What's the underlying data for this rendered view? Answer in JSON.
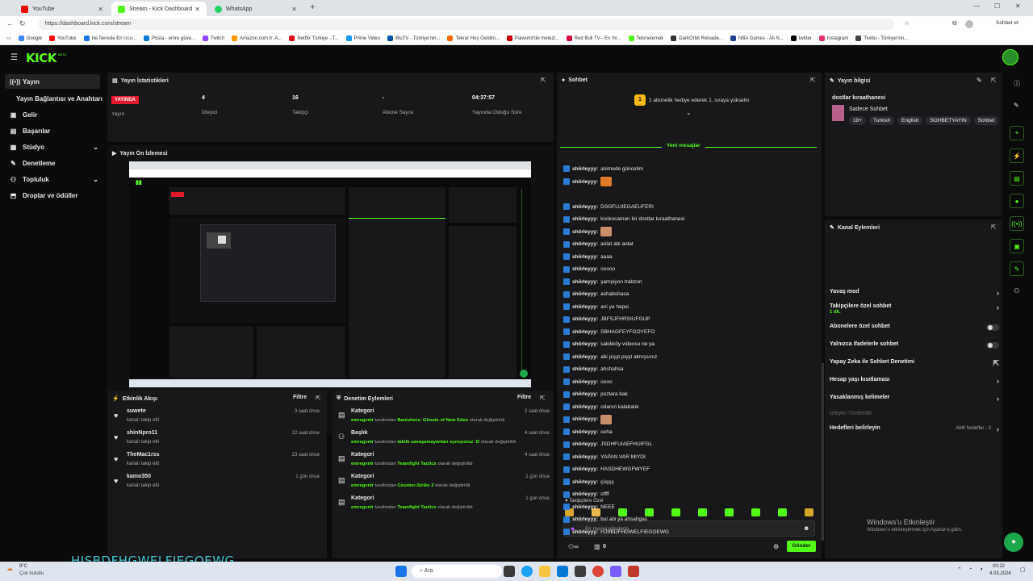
{
  "browser": {
    "tabs": [
      {
        "label": "YouTube",
        "color": "#ff0000"
      },
      {
        "label": "Stream - Kick Dashboard",
        "color": "#53fc18"
      },
      {
        "label": "WhatsApp",
        "color": "#25d366"
      }
    ],
    "url": "https://dashboard.kick.com/stream",
    "profile_label": "Sohbet et",
    "bookmarks": [
      {
        "label": "Google",
        "color": "#4285f4"
      },
      {
        "label": "YouTube",
        "color": "#ff0000"
      },
      {
        "label": "Ne Nerede En Ucu...",
        "color": "#1a73e8"
      },
      {
        "label": "Posta - emre güve...",
        "color": "#0078d4"
      },
      {
        "label": "Twitch",
        "color": "#9146ff"
      },
      {
        "label": "Amazon.com.tr: A...",
        "color": "#ff9900"
      },
      {
        "label": "Netflix Türkiye - T...",
        "color": "#e50914"
      },
      {
        "label": "Prime Video",
        "color": "#1399ff"
      },
      {
        "label": "BluTV - Türkiye'nin...",
        "color": "#0054a6"
      },
      {
        "label": "Tekrar Hoş Geldini...",
        "color": "#ff6600"
      },
      {
        "label": "Palworld'de melezl...",
        "color": "#cc0000"
      },
      {
        "label": "Red Bull TV - En Ye...",
        "color": "#db0a40"
      },
      {
        "label": "Tekmelemek",
        "color": "#53fc18"
      },
      {
        "label": "DarkOrbit Reloade...",
        "color": "#333333"
      },
      {
        "label": "NBA Games - All N...",
        "color": "#1d428a"
      },
      {
        "label": "twitter",
        "color": "#000000"
      },
      {
        "label": "Instagram",
        "color": "#e1306c"
      },
      {
        "label": "Tivibu - Türkiye'nin...",
        "color": "#444444"
      }
    ]
  },
  "app": {
    "logo": "KICK",
    "logo_sup": "BETA",
    "accent": "#53fc18"
  },
  "sidebar": {
    "items": [
      {
        "label": "Yayın",
        "icon": "live-icon"
      },
      {
        "label": "Yayın Bağlantısı ve Anahtarı",
        "icon": ""
      },
      {
        "label": "Gelir",
        "icon": "revenue-icon"
      },
      {
        "label": "Başarılar",
        "icon": "achievements-icon"
      },
      {
        "label": "Stüdyo",
        "icon": "studio-icon"
      },
      {
        "label": "Denetleme",
        "icon": "moderation-icon"
      },
      {
        "label": "Topluluk",
        "icon": "community-icon"
      },
      {
        "label": "Droplar ve ödüller",
        "icon": "drops-icon"
      }
    ]
  },
  "stats": {
    "title": "Yayın İstatistikleri",
    "live_badge": "YAYINDA",
    "live_label": "Yayın",
    "viewers": "4",
    "viewers_label": "İzleyici",
    "followers": "16",
    "followers_label": "Takipçi",
    "subs": "-",
    "subs_label": "Abone Sayısı",
    "uptime": "04:37:57",
    "uptime_label": "Yayında Olduğu Süre"
  },
  "preview": {
    "title": "Yayın Ön İzlemesi"
  },
  "activity": {
    "title": "Etkinlik Akışı",
    "filter": "Filtre",
    "items": [
      {
        "name": "suwete",
        "sub": "kanalı takip etti",
        "time": "3 saat önce"
      },
      {
        "name": "shinNpro11",
        "sub": "kanalı takip etti",
        "time": "22 saat önce"
      },
      {
        "name": "TheMac1rss",
        "sub": "kanalı takip etti",
        "time": "23 saat önce"
      },
      {
        "name": "kamo350",
        "sub": "kanalı takip etti",
        "time": "1 gün önce"
      }
    ]
  },
  "modlog": {
    "title": "Denetim Eylemleri",
    "filter": "Filtre",
    "items": [
      {
        "title": "Kategori",
        "user": "emregvnlr",
        "mid": " tarafından ",
        "value": "Banishers: Ghosts of New Eden",
        "end": " olarak değiştirildi",
        "time": "2 saat önce",
        "icon": "category-icon"
      },
      {
        "title": "Başlık",
        "user": "emregvnlr",
        "mid": " tarafından ",
        "value": "taktik savaşamayanları oynuyoruz :D",
        "end": " olarak değiştirildi",
        "time": "4 saat önce",
        "icon": "title-icon"
      },
      {
        "title": "Kategori",
        "user": "emregvnlr",
        "mid": " tarafından ",
        "value": "Teamfight Tactics",
        "end": " olarak değiştirildi",
        "time": "4 saat önce",
        "icon": "category-icon"
      },
      {
        "title": "Kategori",
        "user": "emregvnlr",
        "mid": " tarafından ",
        "value": "Counter-Strike 2",
        "end": " olarak değiştirildi",
        "time": "1 gün önce",
        "icon": "category-icon"
      },
      {
        "title": "Kategori",
        "user": "emregvnlr",
        "mid": " tarafından ",
        "value": "Teamfight Tactics",
        "end": " olarak değiştirildi",
        "time": "1 gün önce",
        "icon": "category-icon"
      }
    ]
  },
  "chat": {
    "title": "Sohbet",
    "pinned_num": "1",
    "pinned_text": "1 abonelik hediye ederek 1. sıraya yükselin",
    "new_messages": "Yeni mesajlar",
    "messages_before": [
      {
        "user": "shiirleyyy:",
        "text": "animede güncelim",
        "emote": ""
      },
      {
        "user": "shiirleyyy:",
        "text": "",
        "emote": "#e07a2b"
      }
    ],
    "messages": [
      {
        "user": "shiirleyyy:",
        "text": "DSGFLUIEGAEUFERI",
        "emote": ""
      },
      {
        "user": "shiirleyyy:",
        "text": "koskocaman bir dostlar kıraathanesi",
        "emote": ""
      },
      {
        "user": "shiirleyyy:",
        "text": "",
        "emote": "#c98f6d"
      },
      {
        "user": "shiirleyyy:",
        "text": "anlat abi anlat",
        "emote": ""
      },
      {
        "user": "shiirleyyy:",
        "text": "aaaa",
        "emote": ""
      },
      {
        "user": "shiirleyyy:",
        "text": "ooooo",
        "emote": ""
      },
      {
        "user": "shiirleyyy:",
        "text": "şampiyon trabzon",
        "emote": ""
      },
      {
        "user": "shiirleyyy:",
        "text": "ashabshasa",
        "emote": ""
      },
      {
        "user": "shiirleyyy:",
        "text": "ani ya hepsi",
        "emote": ""
      },
      {
        "user": "shiirleyyy:",
        "text": "JBFSJFHRSIUFGUP",
        "emote": ""
      },
      {
        "user": "shiirleyyy:",
        "text": "SBHAGFEYFGOYEFO",
        "emote": ""
      },
      {
        "user": "shiirleyyy:",
        "text": "sakikköy videosu ne ya",
        "emote": ""
      },
      {
        "user": "shiirleyyy:",
        "text": "abi pişşt pişşt almışsınız",
        "emote": ""
      },
      {
        "user": "shiirleyyy:",
        "text": "ahshahsa",
        "emote": ""
      },
      {
        "user": "shiirleyyy:",
        "text": "oooo",
        "emote": ""
      },
      {
        "user": "shiirleyyy:",
        "text": "pozlara bak",
        "emote": ""
      },
      {
        "user": "shiirleyyy:",
        "text": "odanın kalabalık",
        "emote": ""
      },
      {
        "user": "shiirleyyy:",
        "text": "",
        "emote": "#c98f6d"
      },
      {
        "user": "shiirleyyy:",
        "text": "ooha",
        "emote": ""
      },
      {
        "user": "shiirleyyy:",
        "text": "JSDHFUIAEFHUIFGL",
        "emote": ""
      },
      {
        "user": "shiirleyyy:",
        "text": "YAPAN VAR MIYDI",
        "emote": ""
      },
      {
        "user": "shiirleyyy:",
        "text": "HASDHEWGFWYEF",
        "emote": ""
      },
      {
        "user": "shiirleyyy:",
        "text": "çüşşş",
        "emote": ""
      },
      {
        "user": "shiirleyyy:",
        "text": "offff",
        "emote": ""
      },
      {
        "user": "shiirleyyy:",
        "text": "NEEE",
        "emote": ""
      },
      {
        "user": "shiirleyyy:",
        "text": "bul abi ya ahsahgas",
        "emote": ""
      },
      {
        "user": "shiirleyyy:",
        "text": "HJSBDFHGWELFIEGOEWG",
        "emote": ""
      }
    ],
    "followers_only": "Takipçilere Özel",
    "input_placeholder": "Bir mesaj gönderin",
    "send": "Gönder",
    "viewer_count": "0"
  },
  "streaminfo": {
    "title": "Yayın bilgisi",
    "stream_title": "dostlar kıraathanesi",
    "category": "Sadece Sohbet",
    "tags": [
      "18+",
      "Turkish",
      "English",
      "SOHBETYAYIN",
      "Sohbet"
    ]
  },
  "channel_actions": {
    "title": "Kanal Eylemleri",
    "items": [
      {
        "label": "Yavaş mod",
        "type": "chevron"
      },
      {
        "label": "Takipçilere özel sohbet",
        "type": "chevron",
        "sub": "1 dk."
      },
      {
        "label": "Abonelere özel sohbet",
        "type": "toggle"
      },
      {
        "label": "Yalnızca ifadelerle sohbet",
        "type": "toggle"
      },
      {
        "label": "Yapay Zeka ile Sohbet Denetimi",
        "type": "external"
      },
      {
        "label": "Hesap yaşı kısıtlaması",
        "type": "chevron"
      },
      {
        "label": "Yasaklanmış kelimeler",
        "type": "chevron"
      }
    ],
    "redirect_label": "İzleyici Yönlendir",
    "goals_label": "Hedefleri belirleyin",
    "goals_status": "Aktif hedefler - 2"
  },
  "overlay": {
    "windows_title": "Windows'u Etkinleştir",
    "windows_sub": "Windows'u etkinleştirmek için Ayarlar'a gidin.",
    "ticker": "HJSBDFHGWELFIEGOEWG"
  },
  "taskbar": {
    "weather_temp": "9°C",
    "weather_desc": "Çok bulutlu",
    "search": "Ara",
    "time": "00:22",
    "date": "4.03.2024"
  }
}
